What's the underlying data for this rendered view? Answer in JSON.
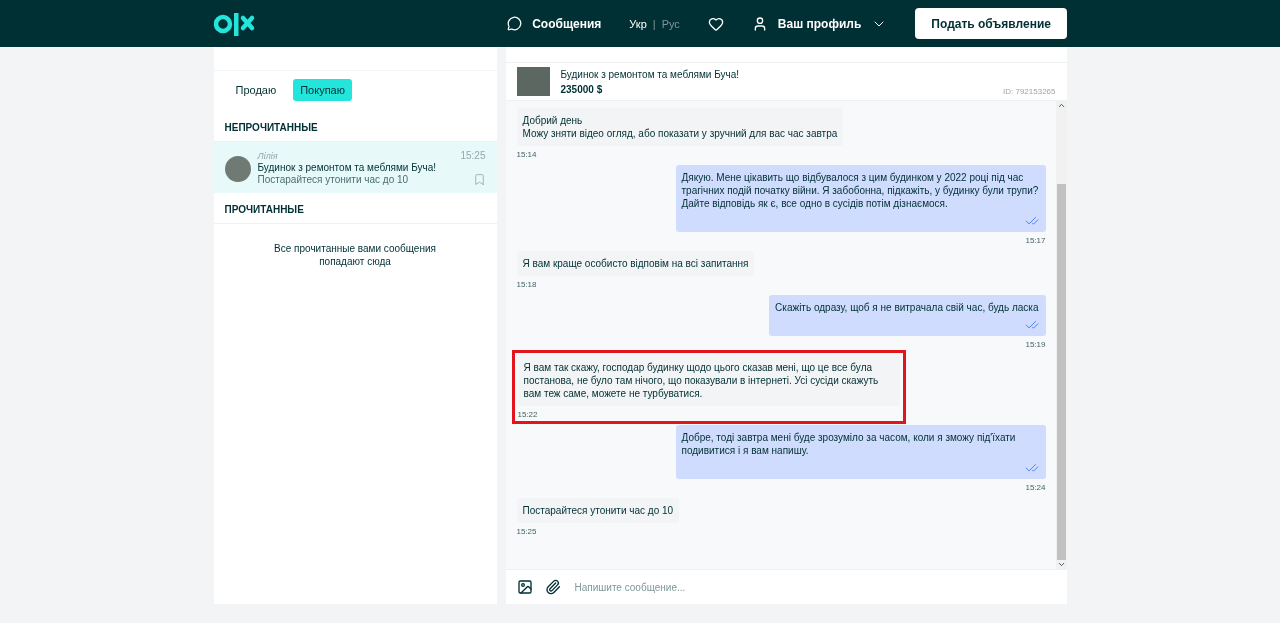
{
  "header": {
    "messages_link": "Сообщения",
    "language_separator": "|",
    "languages": [
      {
        "label": "Укр",
        "selected": true
      },
      {
        "label": "Рус",
        "selected": false
      }
    ],
    "profile": "Ваш профиль",
    "post_button": "Подать объявление"
  },
  "sidebar": {
    "tabs": [
      {
        "label": "Продаю",
        "selected": false
      },
      {
        "label": "Покупаю",
        "selected": true
      }
    ],
    "sections": [
      {
        "title": "НЕПРОЧИТАННЫЕ",
        "conversations": [
          {
            "name": "Лілія",
            "title": "Будинок з ремонтом та меблями Буча!",
            "preview": "Постарайтеся утонити час до 10",
            "time": "15:25"
          }
        ]
      },
      {
        "title": "ПРОЧИТАННЫЕ",
        "empty_text": "Все прочитанные вами сообщения попадают сюда"
      }
    ]
  },
  "listing": {
    "title": "Будинок з ремонтом та меблями Буча!",
    "price": "235000 $",
    "id": "ID: 792153265"
  },
  "messages": [
    {
      "kind": "incoming",
      "text": "Добрий день\nМожу зняти відео огляд, або показати у зручний для вас час завтра",
      "time": "15:14",
      "highlighted": false
    },
    {
      "kind": "outgoing",
      "text": "Дякую. Мене цікавить що відбувалося з цим будинком у 2022 році під час трагічних подій початку війни. Я забобонна, підкажіть, у будинку були трупи? Дайте відповідь як є, все одно в сусідів потім дізнаємося.",
      "time": "15:17",
      "read": true,
      "highlighted": false
    },
    {
      "kind": "incoming",
      "text": "Я вам краще особисто відповім на всі запитання",
      "time": "15:18",
      "highlighted": false
    },
    {
      "kind": "outgoing",
      "text": "Скажіть одразу, щоб я не витрачала свій час, будь ласка",
      "time": "15:19",
      "read": true,
      "highlighted": false
    },
    {
      "kind": "incoming",
      "text": "Я вам так скажу, господар будинку щодо цього сказав мені, що це все була постанова, не було там нічого, що показували в інтернеті. Усі сусіди скажуть вам теж саме, можете не турбуватися.",
      "time": "15:22",
      "highlighted": true
    },
    {
      "kind": "outgoing",
      "text": "Добре, тоді завтра мені буде зрозуміло за часом, коли я зможу під'їхати подивитися і я вам напишу.",
      "time": "15:24",
      "read": true,
      "highlighted": false
    },
    {
      "kind": "incoming",
      "text": "Постарайтеся утонити час до 10",
      "time": "15:25",
      "highlighted": false
    }
  ],
  "composer": {
    "placeholder": "Напишите сообщение..."
  }
}
